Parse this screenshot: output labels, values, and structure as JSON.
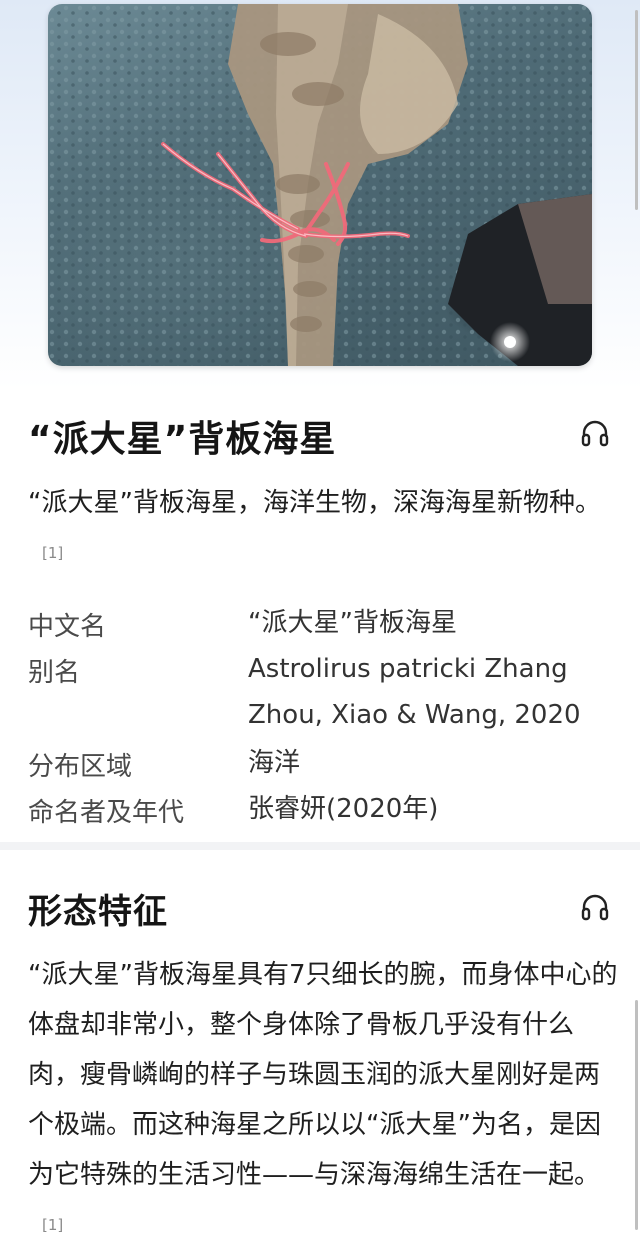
{
  "article": {
    "title": "“派大星”背板海星",
    "intro_text": "“派大星”背板海星，海洋生物，深海海星新物种。",
    "intro_cite": "[1]",
    "info_rows": [
      {
        "key": "中文名",
        "value": "“派大星”背板海星"
      },
      {
        "key": "别名",
        "value": "Astrolirus patricki Zhang Zhou, Xiao & Wang, 2020"
      },
      {
        "key": "分布区域",
        "value": "海洋"
      },
      {
        "key": "命名者及年代",
        "value": "张睿妍(2020年)"
      }
    ]
  },
  "section": {
    "title": "形态特征",
    "text": "“派大星”背板海星具有7只细长的腕，而身体中心的体盘却非常小，整个身体除了骨板几乎没有什么肉，瘦骨嶙峋的样子与珠圆玉润的派大星刚好是两个极端。而这种海星之所以以“派大星”为名，是因为它特殊的生活习性——与深海海绵生活在一起。",
    "cite": "[1]"
  },
  "icons": {
    "title_listen": "headphones-icon",
    "section_listen": "headphones-icon"
  },
  "colors": {
    "starfish": "#f06a7a",
    "text": "#1f1f1f",
    "muted": "#8a8a8a"
  }
}
